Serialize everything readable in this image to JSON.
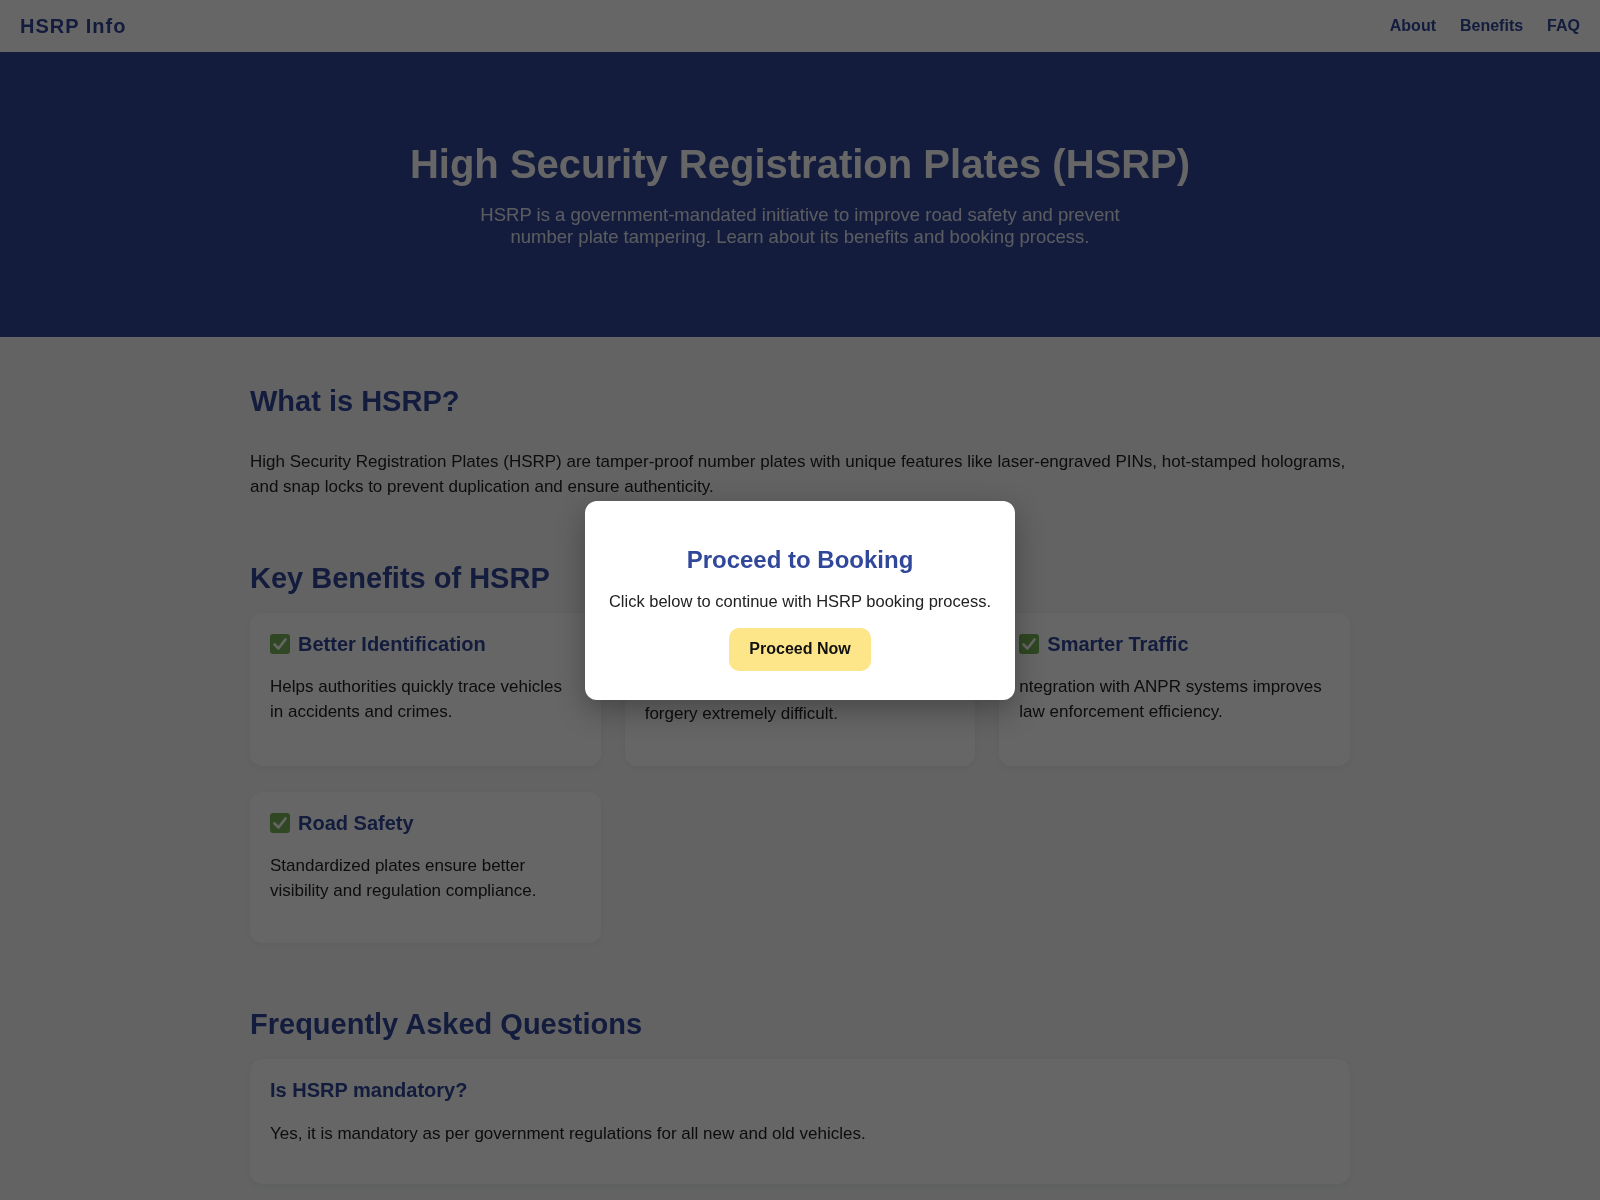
{
  "nav": {
    "logo": "HSRP Info",
    "links": [
      "About",
      "Benefits",
      "FAQ"
    ]
  },
  "hero": {
    "title": "High Security Registration Plates (HSRP)",
    "subtitle": "HSRP is a government-mandated initiative to improve road safety and prevent number plate tampering. Learn about its benefits and booking process."
  },
  "about": {
    "heading": "What is HSRP?",
    "text": "High Security Registration Plates (HSRP) are tamper-proof number plates with unique features like laser-engraved PINs, hot-stamped holograms, and snap locks to prevent duplication and ensure authenticity."
  },
  "benefits": {
    "heading": "Key Benefits of HSRP",
    "cards": [
      {
        "title": "Better Identification",
        "text": "Helps authorities quickly trace vehicles in accidents and crimes."
      },
      {
        "text": "forgery extremely difficult."
      },
      {
        "title": "Smarter Traffic",
        "text": "ntegration with ANPR systems improves law enforcement efficiency."
      },
      {
        "title": "Road Safety",
        "text": "Standardized plates ensure better visibility and regulation compliance."
      }
    ]
  },
  "faq": {
    "heading": "Frequently Asked Questions",
    "items": [
      {
        "question": "Is HSRP mandatory?",
        "answer": "Yes, it is mandatory as per government regulations for all new and old vehicles."
      }
    ]
  },
  "modal": {
    "title": "Proceed to Booking",
    "text": "Click below to continue with HSRP booking process.",
    "button": "Proceed Now"
  }
}
